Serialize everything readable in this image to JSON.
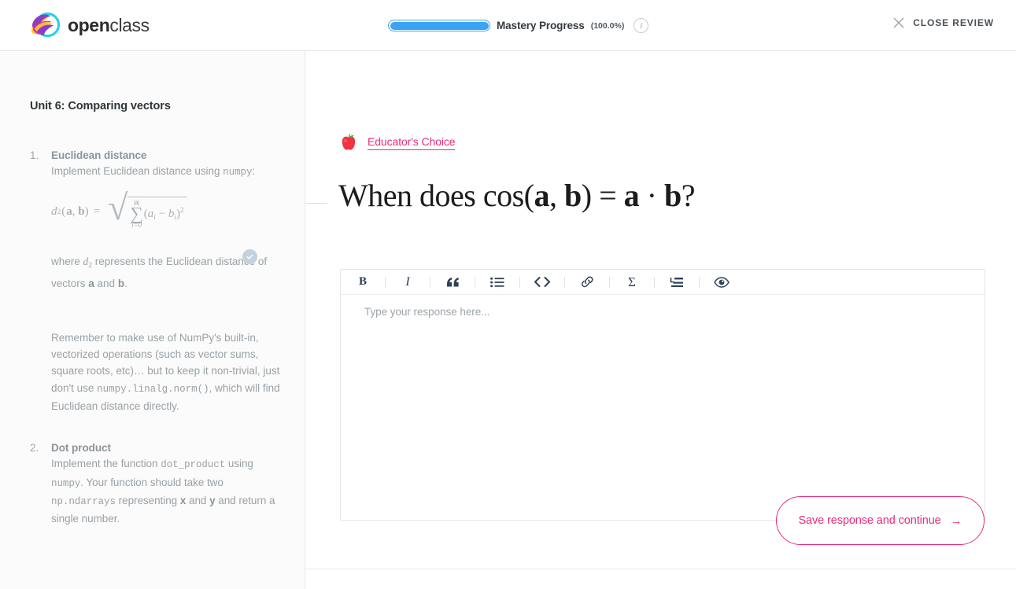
{
  "header": {
    "logo_bold": "open",
    "logo_light": "class",
    "progress": {
      "label": "Mastery Progress",
      "percent_text": "(100.0%)",
      "value": 100,
      "fill_color": "#3ba3f2",
      "info_glyph": "i"
    },
    "close_review_label": "CLOSE REVIEW"
  },
  "sidebar": {
    "unit_title": "Unit 6: Comparing vectors",
    "tasks": [
      {
        "number": "1.",
        "title": "Euclidean distance",
        "intro_pre": "Implement Euclidean distance using ",
        "intro_code": "numpy",
        "intro_post": ":",
        "formula": {
          "lhs_d": "d",
          "lhs_sub": "2",
          "lhs_args": "(a, b)",
          "equals": "=",
          "sum_upper": "|a|",
          "sum_lower": "i=0",
          "sum_body": "(a",
          "sum_body_sub_i": "i",
          "sum_minus": " − b",
          "sum_body_sub_i2": "i",
          "sum_close": ")",
          "sum_power": "2"
        },
        "where_pre": "where ",
        "where_d": "d",
        "where_sub": "2",
        "where_mid": " represents the Euclidean distance of vectors ",
        "where_a": "a",
        "where_and": " and ",
        "where_b": "b",
        "where_end": ".",
        "completed": true,
        "remember": {
          "part1": "Remember to make use of NumPy's built-in, vectorized operations (such as vector sums, square roots, etc)… but to keep it non-trivial, just don't use ",
          "code": "numpy.linalg.norm()",
          "part2": ", which will find Euclidean distance directly."
        }
      },
      {
        "number": "2.",
        "title": "Dot product",
        "line_pre": "Implement the function ",
        "code1": "dot_product",
        "line_mid1": " using ",
        "code2": "numpy",
        "line_mid2": ". Your function should take two ",
        "code3": "np.ndarrays",
        "line_mid3": " representing ",
        "var_x": "x",
        "line_mid4": " and ",
        "var_y": "y",
        "line_end": " and return a single number."
      }
    ]
  },
  "main": {
    "educators_choice_label": "Educator's Choice",
    "educators_choice_icon": "apple-icon",
    "accent_color": "#ec2a7b",
    "question": {
      "prefix": "When does ",
      "cos": "cos",
      "open_paren": "(",
      "vec_a": "a",
      "comma": ", ",
      "vec_b": "b",
      "close_paren": ")",
      "equals": " = ",
      "vec_a2": "a",
      "dot": " · ",
      "vec_b2": "b",
      "question_mark": "?"
    },
    "toolbar": [
      {
        "name": "bold-icon",
        "label": "B"
      },
      {
        "name": "italic-icon",
        "label": "I"
      },
      {
        "name": "quote-icon",
        "label": "“"
      },
      {
        "name": "bullet-list-icon",
        "label": "list"
      },
      {
        "name": "code-icon",
        "label": "<>"
      },
      {
        "name": "link-icon",
        "label": "link"
      },
      {
        "name": "sigma-icon",
        "label": "Σ"
      },
      {
        "name": "indent-icon",
        "label": "indent"
      },
      {
        "name": "preview-eye-icon",
        "label": "eye"
      }
    ],
    "editor_placeholder": "Type your response here...",
    "save_button_label": "Save response and continue",
    "save_button_arrow": "→"
  }
}
